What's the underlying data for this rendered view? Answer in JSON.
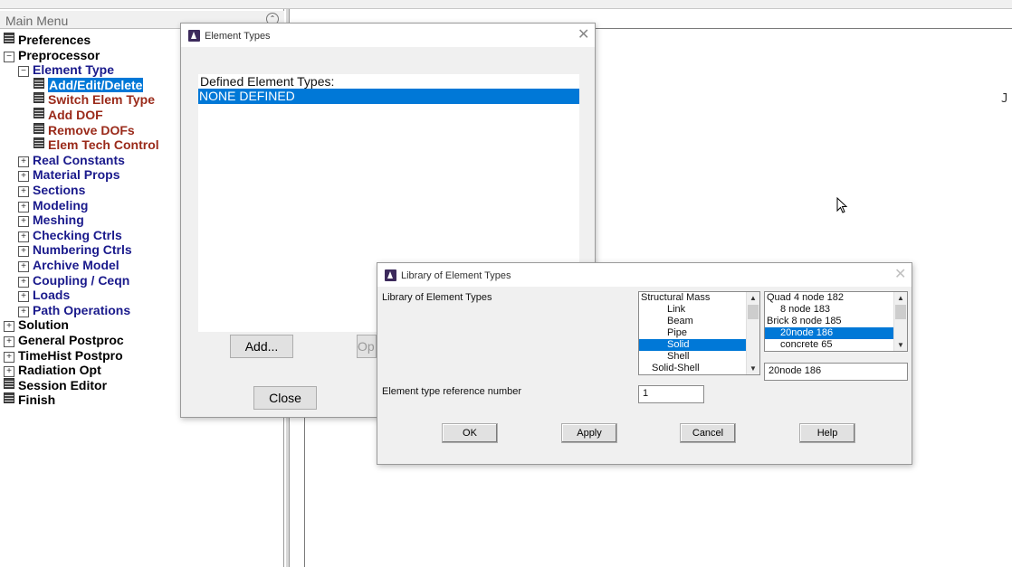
{
  "main_menu": {
    "title": "Main Menu",
    "items": [
      {
        "label": "Preferences",
        "level": 0,
        "glyph": "doc"
      },
      {
        "label": "Preprocessor",
        "level": 0,
        "glyph": "minus"
      },
      {
        "label": "Element Type",
        "level": 1,
        "glyph": "minus"
      },
      {
        "label": "Add/Edit/Delete",
        "level": 2,
        "glyph": "doc",
        "selected": true
      },
      {
        "label": "Switch Elem Type",
        "level": 2,
        "glyph": "doc"
      },
      {
        "label": "Add DOF",
        "level": 2,
        "glyph": "doc"
      },
      {
        "label": "Remove DOFs",
        "level": 2,
        "glyph": "doc"
      },
      {
        "label": "Elem Tech Control",
        "level": 2,
        "glyph": "doc"
      },
      {
        "label": "Real Constants",
        "level": 1,
        "glyph": "plus"
      },
      {
        "label": "Material Props",
        "level": 1,
        "glyph": "plus"
      },
      {
        "label": "Sections",
        "level": 1,
        "glyph": "plus"
      },
      {
        "label": "Modeling",
        "level": 1,
        "glyph": "plus"
      },
      {
        "label": "Meshing",
        "level": 1,
        "glyph": "plus"
      },
      {
        "label": "Checking Ctrls",
        "level": 1,
        "glyph": "plus"
      },
      {
        "label": "Numbering Ctrls",
        "level": 1,
        "glyph": "plus"
      },
      {
        "label": "Archive Model",
        "level": 1,
        "glyph": "plus"
      },
      {
        "label": "Coupling / Ceqn",
        "level": 1,
        "glyph": "plus"
      },
      {
        "label": "Loads",
        "level": 1,
        "glyph": "plus"
      },
      {
        "label": "Path Operations",
        "level": 1,
        "glyph": "plus"
      },
      {
        "label": "Solution",
        "level": 0,
        "glyph": "plus"
      },
      {
        "label": "General Postproc",
        "level": 0,
        "glyph": "plus"
      },
      {
        "label": "TimeHist Postpro",
        "level": 0,
        "glyph": "plus"
      },
      {
        "label": "Radiation Opt",
        "level": 0,
        "glyph": "plus"
      },
      {
        "label": "Session Editor",
        "level": 0,
        "glyph": "doc"
      },
      {
        "label": "Finish",
        "level": 0,
        "glyph": "doc"
      }
    ]
  },
  "graphics": {
    "corner_text": "J"
  },
  "element_types_dialog": {
    "title": "Element Types",
    "list_label": "Defined Element Types:",
    "list_value": "NONE DEFINED",
    "add_button": "Add...",
    "options_button": "Op",
    "close_button": "Close"
  },
  "library_dialog": {
    "title": "Library of Element Types",
    "library_label": "Library of Element Types",
    "categories": [
      "Structural Mass",
      "Link",
      "Beam",
      "Pipe",
      "Solid",
      "Shell",
      "Solid-Shell"
    ],
    "selected_category": "Solid",
    "types": [
      "Quad  4 node 182",
      "8 node 183",
      "Brick 8 node 185",
      "20node 186",
      "concrete 65"
    ],
    "selected_type": "20node 186",
    "selected_type_display": "20node 186",
    "ref_number_label": "Element type reference number",
    "ref_number_value": "1",
    "ok_button": "OK",
    "apply_button": "Apply",
    "cancel_button": "Cancel",
    "help_button": "Help"
  },
  "colors": {
    "selection": "#0078d7",
    "menu_level1": "#1a1a8c",
    "menu_level2": "#9a2a1a",
    "app_icon": "#3c2a5c"
  }
}
